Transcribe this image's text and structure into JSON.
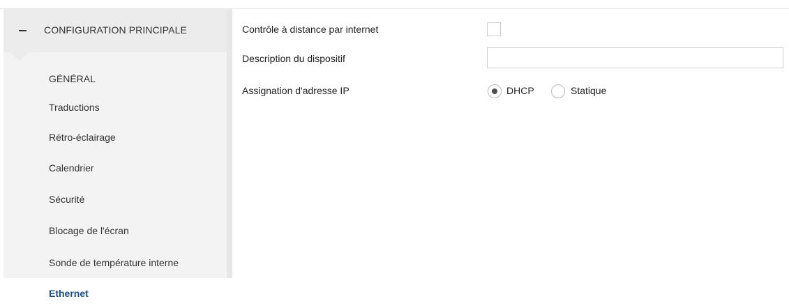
{
  "sidebar": {
    "group": {
      "label": "CONFIGURATION PRINCIPALE",
      "expanded": true,
      "collapse_symbol": "−"
    },
    "items": [
      {
        "label": "GÉNÉRAL"
      },
      {
        "label": "Traductions"
      },
      {
        "label": "Rétro-éclairage"
      },
      {
        "label": "Calendrier"
      },
      {
        "label": "Sécurité"
      },
      {
        "label": "Blocage de l'écran"
      },
      {
        "label": "Sonde de température interne"
      },
      {
        "label": "Ethernet",
        "active": true
      }
    ],
    "active_color": "#1a4f86"
  },
  "main": {
    "remote_control": {
      "label": "Contrôle à distance par internet",
      "checked": false
    },
    "device_description": {
      "label": "Description du dispositif",
      "value": ""
    },
    "ip_assignment": {
      "label": "Assignation d'adresse IP",
      "options": [
        {
          "label": "DHCP",
          "selected": true
        },
        {
          "label": "Statique",
          "selected": false
        }
      ]
    }
  }
}
